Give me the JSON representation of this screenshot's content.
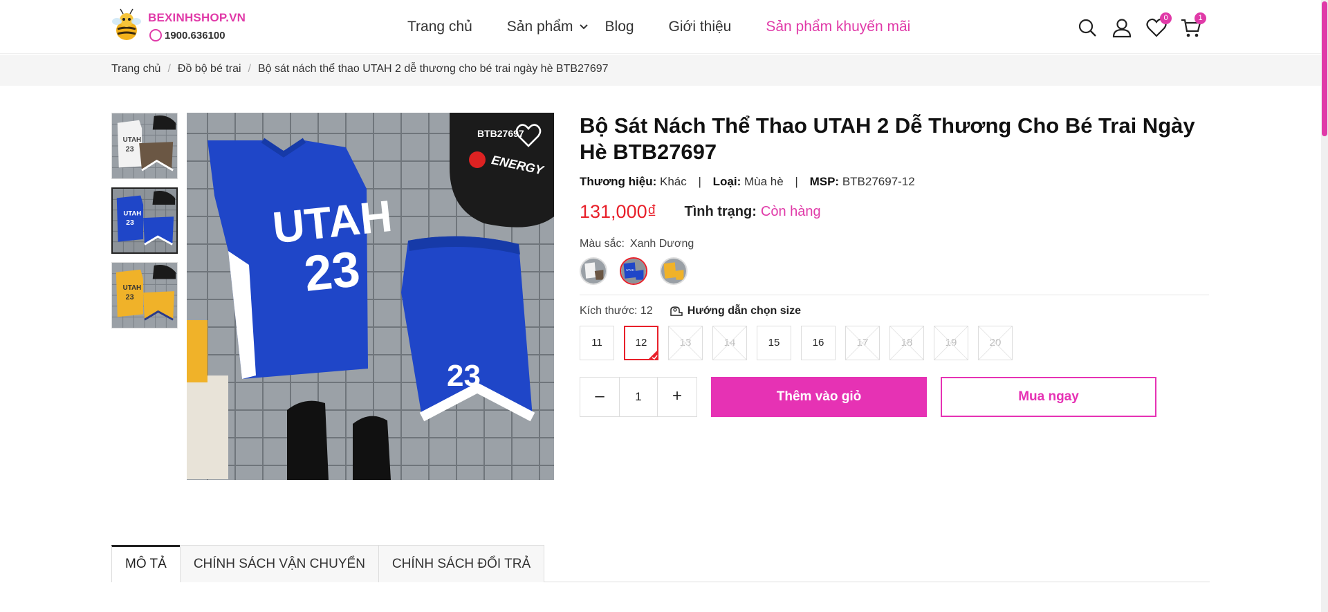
{
  "brand": {
    "name": "BEXINHSHOP.VN",
    "phone": "1900.636100",
    "accent_color": "#e03aa8"
  },
  "nav": {
    "items": [
      {
        "label": "Trang chủ"
      },
      {
        "label": "Sản phẩm"
      },
      {
        "label": "Blog"
      },
      {
        "label": "Giới thiệu"
      },
      {
        "label": "Sản phẩm khuyến mãi"
      }
    ]
  },
  "header_icons": {
    "search": "search-icon",
    "account": "user-icon",
    "wishlist": "heart-icon",
    "wishlist_count": "0",
    "cart": "cart-icon",
    "cart_count": "1"
  },
  "breadcrumb": {
    "items": [
      "Trang chủ",
      "Đồ bộ bé trai",
      "Bộ sát nách thể thao UTAH 2 dễ thương cho bé trai ngày hè BTB27697"
    ],
    "separator": "/"
  },
  "product": {
    "title": "Bộ Sát Nách Thể Thao UTAH 2 Dễ Thương Cho Bé Trai Ngày Hè BTB27697",
    "brand_label": "Thương hiệu:",
    "brand_value": "Khác",
    "type_label": "Loại:",
    "type_value": "Mùa hè",
    "sku_label": "MSP:",
    "sku_value": "BTB27697-12",
    "price": "131,000₫",
    "price_color": "#e8202a",
    "stock_label": "Tình trạng:",
    "stock_value": "Còn hàng",
    "color_label": "Màu sắc:",
    "color_value": "Xanh Dương",
    "size_label": "Kích thước:",
    "size_value": "12",
    "size_guide": "Hướng dẫn chọn size",
    "sizes": [
      {
        "label": "11",
        "state": "available"
      },
      {
        "label": "12",
        "state": "selected"
      },
      {
        "label": "13",
        "state": "unavailable"
      },
      {
        "label": "14",
        "state": "unavailable"
      },
      {
        "label": "15",
        "state": "available"
      },
      {
        "label": "16",
        "state": "available"
      },
      {
        "label": "17",
        "state": "unavailable"
      },
      {
        "label": "18",
        "state": "unavailable"
      },
      {
        "label": "19",
        "state": "unavailable"
      },
      {
        "label": "20",
        "state": "unavailable"
      }
    ],
    "swatches": [
      "white",
      "blue",
      "yellow"
    ],
    "selected_swatch": "blue",
    "jersey_text": "UTAH",
    "jersey_number": "23",
    "cap_text": "BTB27697",
    "cap_brand": "ENERGY",
    "quantity": "1",
    "qty_minus": "–",
    "qty_plus": "+",
    "add_to_cart": "Thêm vào giỏ",
    "buy_now": "Mua ngay"
  },
  "tabs": [
    {
      "label": "MÔ TẢ",
      "active": true
    },
    {
      "label": "CHÍNH SÁCH VẬN CHUYỂN",
      "active": false
    },
    {
      "label": "CHÍNH SÁCH ĐỔI TRẢ",
      "active": false
    }
  ]
}
